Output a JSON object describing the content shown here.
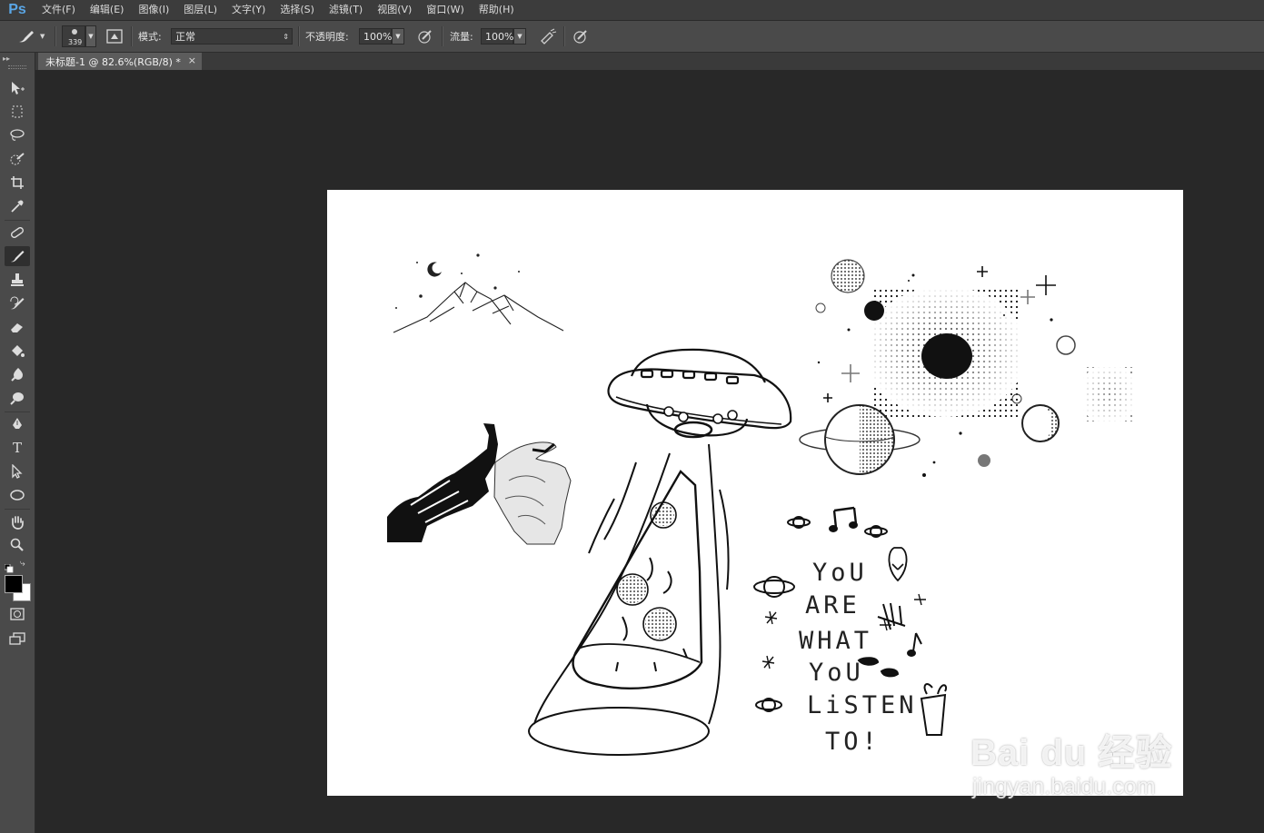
{
  "app": {
    "logo": "Ps"
  },
  "menu": [
    "文件(F)",
    "编辑(E)",
    "图像(I)",
    "图层(L)",
    "文字(Y)",
    "选择(S)",
    "滤镜(T)",
    "视图(V)",
    "窗口(W)",
    "帮助(H)"
  ],
  "options": {
    "brush_size": "339",
    "mode_label": "模式:",
    "mode_value": "正常",
    "opacity_label": "不透明度:",
    "opacity_value": "100%",
    "flow_label": "流量:",
    "flow_value": "100%"
  },
  "document": {
    "tab_title": "未标题-1 @ 82.6%(RGB/8) *",
    "close_glyph": "×"
  },
  "artwork": {
    "lyrics": [
      "YoU",
      "ARE",
      "WHAT",
      "YoU",
      "LiSTEN",
      "TO!"
    ]
  },
  "watermark": {
    "brand": "Bai du 经验",
    "url": "jingyan.baidu.com"
  },
  "colors": {
    "menubar": "#3c3c3c",
    "panel": "#4a4a4a",
    "workspace": "#282828",
    "canvas": "#ffffff",
    "ps_blue": "#5aa6e6"
  }
}
